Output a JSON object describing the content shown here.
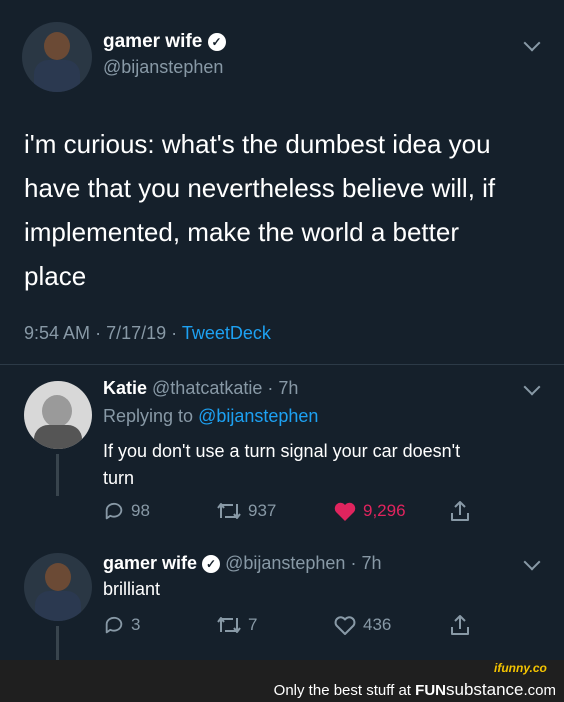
{
  "tweet": {
    "name": "gamer wife",
    "handle": "@bijanstephen",
    "text": "i'm curious: what's the dumbest idea you have that you nevertheless believe will, if implemented, make the world a better place",
    "lines": [
      "i'm curious: what's the dumbest idea you",
      "have that you nevertheless believe will, if",
      "implemented, make the world a better",
      "place"
    ],
    "time": "9:54 AM",
    "date": "7/17/19",
    "source": "TweetDeck"
  },
  "reply1": {
    "name": "Katie",
    "handle": "@thatcatkatie",
    "age": "· 7h",
    "replying_prefix": "Replying to",
    "replying_handle": "@bijanstephen",
    "text_lines": [
      "If you don't use a turn signal your car doesn't",
      "turn"
    ],
    "replies": "98",
    "retweets": "937",
    "likes": "9,296"
  },
  "reply2": {
    "name": "gamer wife",
    "handle": "@bijanstephen",
    "age": "· 7h",
    "text": "brilliant",
    "replies": "3",
    "retweets": "7",
    "likes": "436"
  },
  "footer": {
    "watermark": "ifunny.co",
    "tagline": "Only the best stuff at",
    "brand_bold": "FUN",
    "brand_rest": "substance",
    "brand_tld": ".com"
  },
  "colors": {
    "background": "#15202b",
    "link": "#1da1f2",
    "muted": "#8899a6",
    "like_active": "#e0245e"
  },
  "icons": [
    "verified-icon",
    "chevron-down-icon",
    "reply-icon",
    "retweet-icon",
    "heart-icon",
    "share-icon"
  ]
}
